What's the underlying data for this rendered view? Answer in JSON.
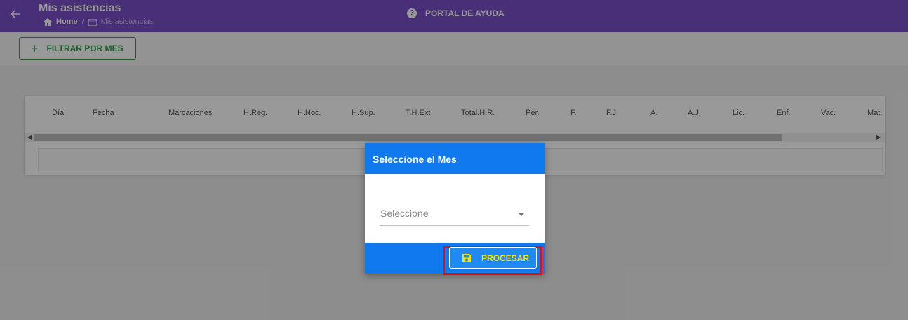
{
  "header": {
    "title": "Mis asistencias",
    "breadcrumb": {
      "home": "Home",
      "separator": "/",
      "current": "Mis asistencias"
    },
    "help_label": "PORTAL DE AYUDA",
    "help_icon": "question-icon",
    "back_icon": "arrow-left-icon",
    "color": "#7b4fc9"
  },
  "toolbar": {
    "filter_label": "FILTRAR POR MES",
    "filter_icon": "plus-icon",
    "filter_color": "#2e9a4a"
  },
  "table": {
    "columns": [
      "Día",
      "Fecha",
      "Marcaciones",
      "H.Reg.",
      "H.Noc.",
      "H.Sup.",
      "T.H.Ext",
      "Total.H.R.",
      "Per.",
      "F.",
      "F.J.",
      "A.",
      "A.J.",
      "Lic.",
      "Enf.",
      "Vac.",
      "Mat."
    ]
  },
  "dialog": {
    "title": "Seleccione el Mes",
    "select_placeholder": "Seleccione",
    "process_label": "PROCESAR",
    "process_icon": "save-icon",
    "accent": "#1179ee",
    "highlight_color": "#e0101a"
  }
}
